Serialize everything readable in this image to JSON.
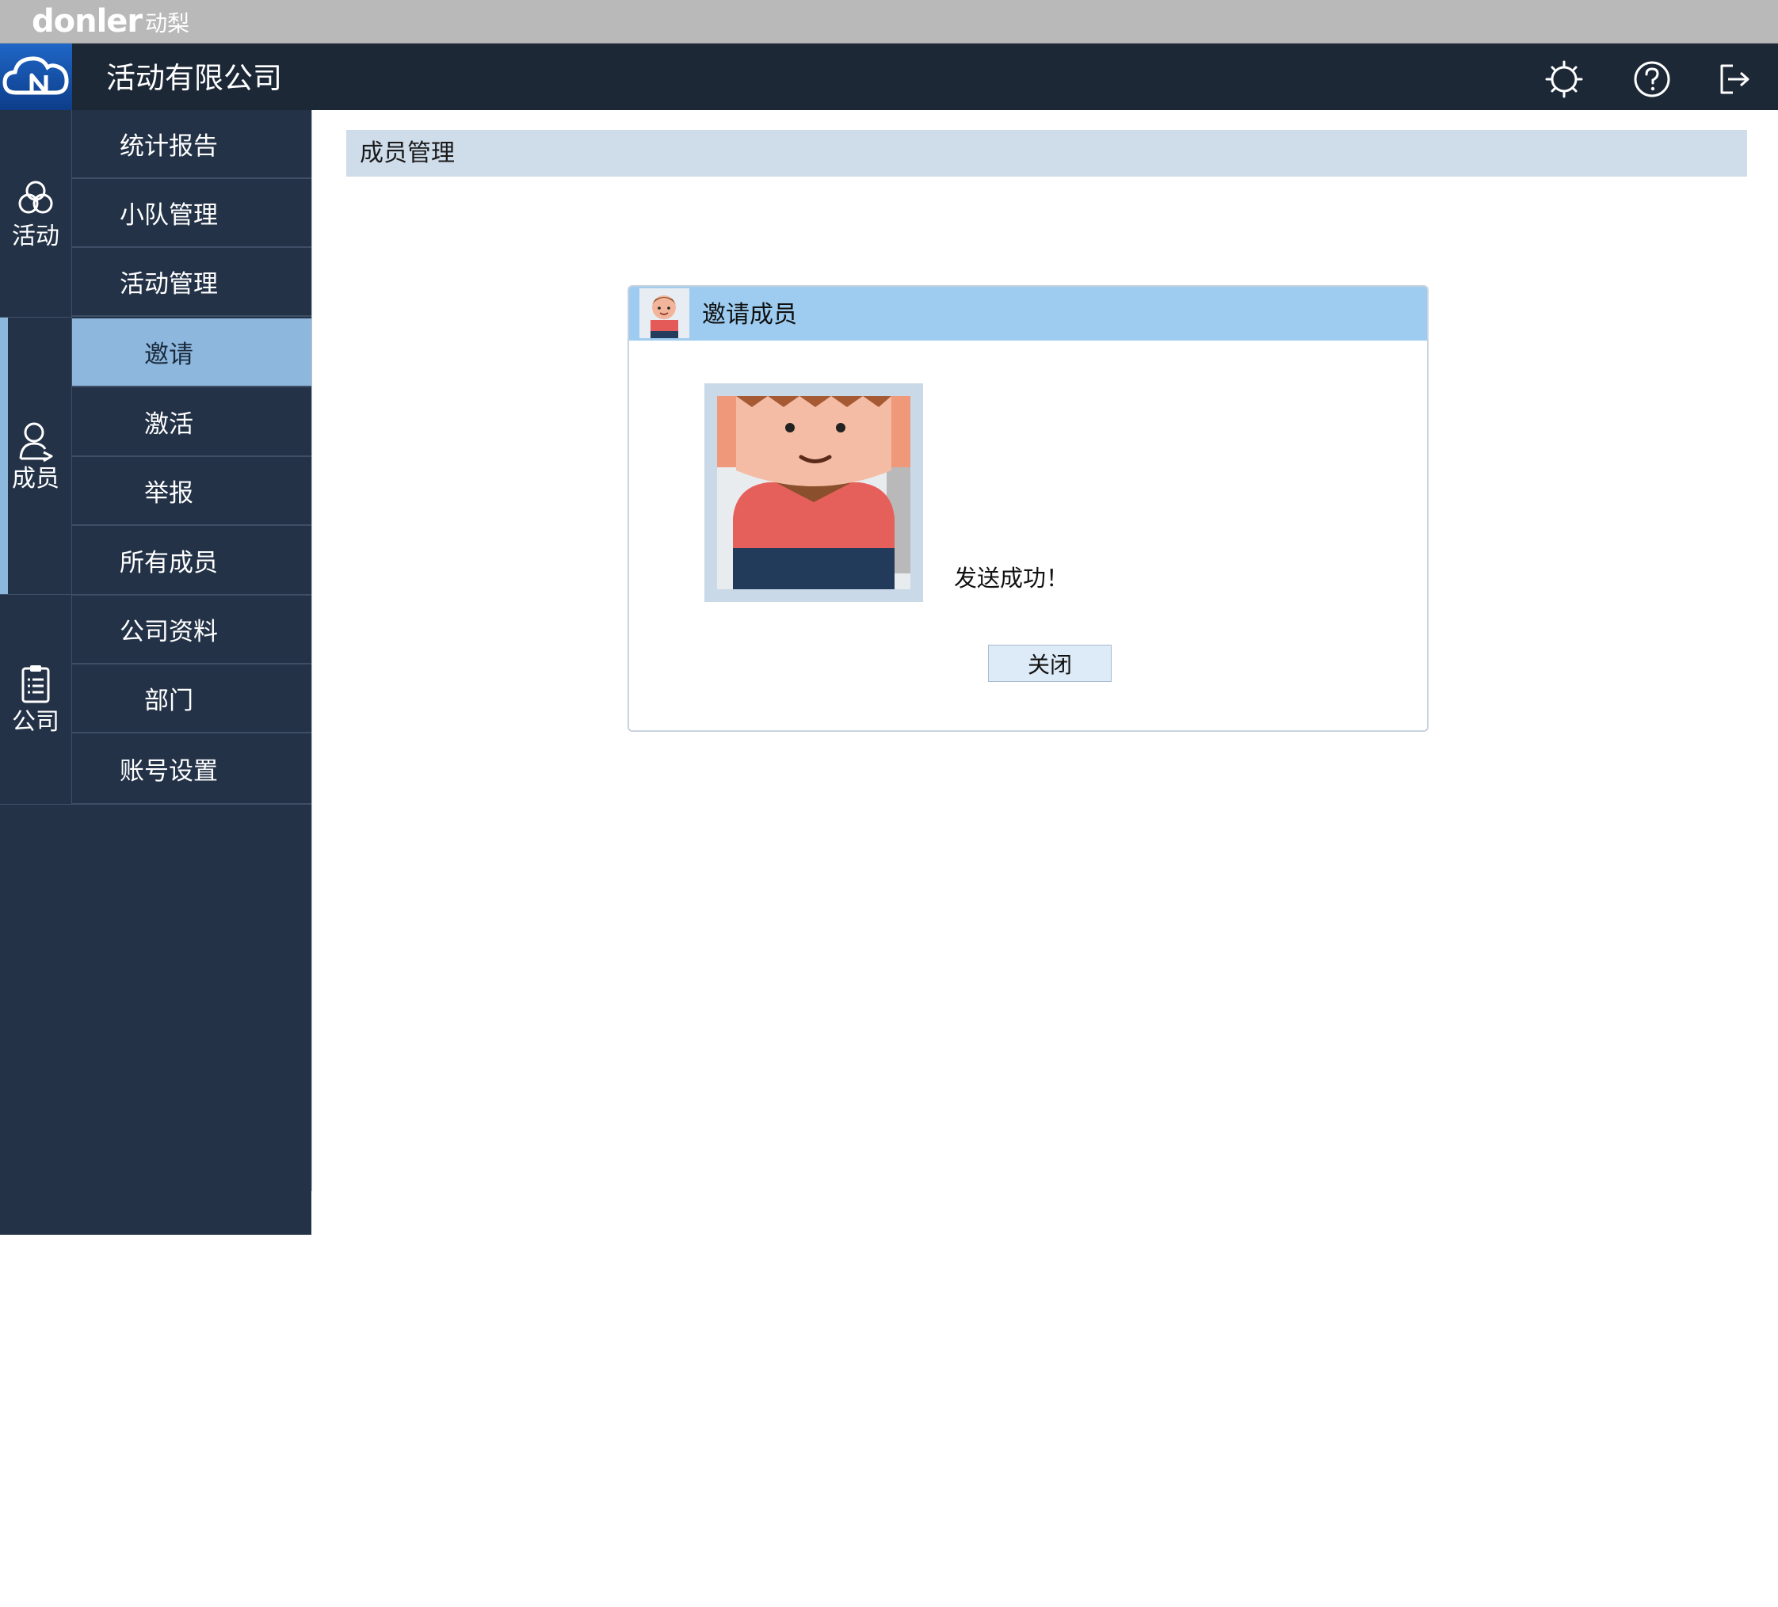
{
  "brand": {
    "word": "donler",
    "cn": "动梨"
  },
  "header": {
    "company_title": "活动有限公司",
    "icons": [
      "settings-gear-icon",
      "help-circle-icon",
      "logout-icon"
    ]
  },
  "sidebar": {
    "groups": [
      {
        "label": "活动",
        "icon": "activity-circles-icon"
      },
      {
        "label": "成员",
        "icon": "member-person-icon"
      },
      {
        "label": "公司",
        "icon": "clipboard-icon"
      }
    ],
    "items": [
      {
        "label": "统计报告"
      },
      {
        "label": "小队管理"
      },
      {
        "label": "活动管理"
      },
      {
        "label": "邀请",
        "selected": true
      },
      {
        "label": "激活"
      },
      {
        "label": "举报"
      },
      {
        "label": "所有成员"
      },
      {
        "label": "公司资料"
      },
      {
        "label": "部门"
      },
      {
        "label": "账号设置"
      }
    ]
  },
  "main": {
    "page_title": "成员管理",
    "dialog": {
      "title": "邀请成员",
      "message": "发送成功！",
      "close_label": "关闭"
    }
  },
  "colors": {
    "topbar": "#b9b9b9",
    "header": "#1d2837",
    "sidebar": "#233247",
    "menu_selected": "#8db7dc",
    "page_head": "#cfdcea",
    "dialog_head": "#9dccf0",
    "button": "#ddeaf7"
  }
}
